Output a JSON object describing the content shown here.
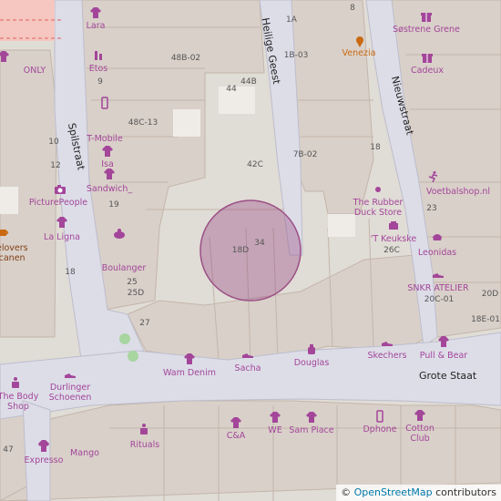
{
  "streets": {
    "spilstraat": "Spilstraat",
    "heilige_geest": "Heilige Geest",
    "nieuwstraat": "Nieuwstraat",
    "grote_staat": "Grote Staat"
  },
  "pois": [
    {
      "label": "Lara",
      "icon": "shop-clothes-icon"
    },
    {
      "label": "Søstrene Grene",
      "icon": "gift-icon"
    },
    {
      "label": "ONLY",
      "icon": "shop-clothes-icon"
    },
    {
      "label": "Etos",
      "icon": "chemist-icon"
    },
    {
      "label": "Venezia",
      "icon": "ice-cream-icon"
    },
    {
      "label": "Cadeux",
      "icon": "gift-icon"
    },
    {
      "label": "T-Mobile",
      "icon": "mobile-phone-icon"
    },
    {
      "label": "Isa",
      "icon": "shop-clothes-icon"
    },
    {
      "label": "Sandwich_",
      "icon": "shop-clothes-icon"
    },
    {
      "label": "PicturePeople",
      "icon": "camera-icon"
    },
    {
      "label": "La Ligna",
      "icon": "shop-clothes-icon"
    },
    {
      "label": "Boulanger",
      "icon": "bakery-icon"
    },
    {
      "label": "The Rubber Duck Store",
      "icon": "shop-icon"
    },
    {
      "label": "'T Keukske",
      "icon": "kitchen-icon"
    },
    {
      "label": "Voetbalshop.nl",
      "icon": "sports-icon"
    },
    {
      "label": "Leonidas",
      "icon": "confectionery-icon"
    },
    {
      "label": "SNKR ATELIER",
      "icon": "shoe-icon"
    },
    {
      "label": "Pull & Bear",
      "icon": "shop-clothes-icon"
    },
    {
      "label": "Skechers",
      "icon": "shoe-icon"
    },
    {
      "label": "Douglas",
      "icon": "perfumery-icon"
    },
    {
      "label": "Sacha",
      "icon": "shoe-icon"
    },
    {
      "label": "Wam Denim",
      "icon": "shop-clothes-icon"
    },
    {
      "label": "Durlinger Schoenen",
      "icon": "shoe-icon"
    },
    {
      "label": "The Body Shop",
      "icon": "cosmetics-icon"
    },
    {
      "label": "Mango",
      "icon": "shop-clothes-icon"
    },
    {
      "label": "Expresso",
      "icon": "shop-clothes-icon"
    },
    {
      "label": "Rituals",
      "icon": "cosmetics-icon"
    },
    {
      "label": "C&A",
      "icon": "shop-clothes-icon"
    },
    {
      "label": "WE",
      "icon": "shop-clothes-icon"
    },
    {
      "label": "Sam Piace",
      "icon": "shop-clothes-icon"
    },
    {
      "label": "Dphone",
      "icon": "mobile-phone-icon"
    },
    {
      "label": "Cotton Club",
      "icon": "shop-clothes-icon"
    },
    {
      "label": "elovers icanen",
      "icon": "cafe-icon"
    }
  ],
  "house_numbers": [
    "8",
    "1A",
    "1B-03",
    "48B-02",
    "9",
    "44",
    "44B",
    "48C-13",
    "10",
    "18",
    "7B-02",
    "12",
    "42C",
    "19",
    "23",
    "34",
    "18D",
    "26C",
    "18",
    "25",
    "25D",
    "20C-01",
    "20D",
    "27",
    "18E-01",
    "47"
  ],
  "selection_circle": {
    "meaning": "highlighted-address-area"
  },
  "attribution": {
    "prefix": "© ",
    "link": "OpenStreetMap",
    "suffix": " contributors"
  },
  "colors": {
    "road": "#ffffff",
    "pedestrian": "#dddde8",
    "building": "#d9d0c9",
    "building_stroke": "#c4b6ab",
    "background": "#e0dcd6",
    "poi_purple": "#a3469a",
    "poi_orange": "#c96a12",
    "circle_fill": "#9c4f86",
    "attribution_link": "#0078a8"
  }
}
